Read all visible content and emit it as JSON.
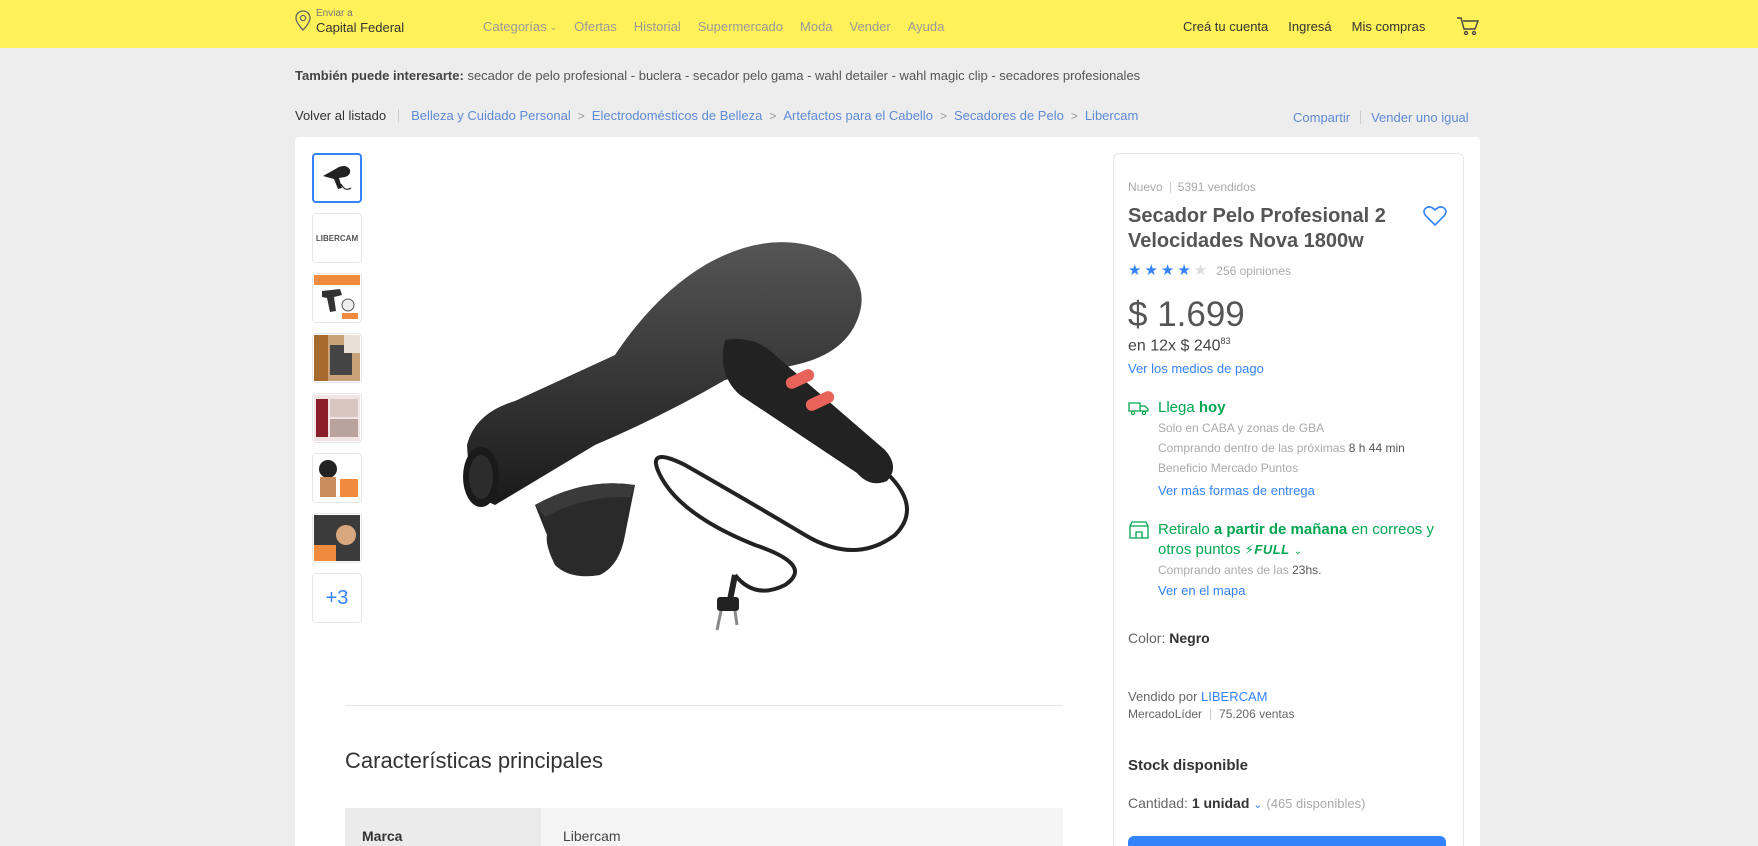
{
  "header": {
    "location": {
      "label": "Enviar a",
      "value": "Capital Federal"
    },
    "categories": [
      {
        "label": "Categorías",
        "has_chevron": true
      },
      {
        "label": "Ofertas"
      },
      {
        "label": "Historial"
      },
      {
        "label": "Supermercado"
      },
      {
        "label": "Moda"
      },
      {
        "label": "Vender"
      },
      {
        "label": "Ayuda"
      }
    ],
    "account": [
      "Creá tu cuenta",
      "Ingresá",
      "Mis compras"
    ],
    "cart_icon": "cart-icon",
    "bg_color": "#fff159"
  },
  "also_interest": {
    "label": "También puede interesarte:",
    "text": "secador de pelo profesional - buclera - secador pelo gama - wahl detailer - wahl magic clip - secadores profesionales"
  },
  "breadcrumb": {
    "back": "Volver al listado",
    "items": [
      "Belleza y Cuidado Personal",
      "Electrodomésticos de Belleza",
      "Artefactos para el Cabello",
      "Secadores de Pelo",
      "Libercam"
    ],
    "share": "Compartir",
    "sell_same": "Vender uno igual"
  },
  "gallery": {
    "thumbnails": [
      "hair-dryer",
      "libercam-logo",
      "product-promo",
      "product-lifestyle",
      "product-collage",
      "model-promo",
      "model-with-dryer"
    ],
    "more": "+3",
    "thumb_logo_text": "LIBERCAM"
  },
  "features": {
    "title": "Características principales",
    "rows": [
      {
        "key": "Marca",
        "value": "Libercam"
      }
    ]
  },
  "product": {
    "condition": "Nuevo",
    "sold": "5391 vendidos",
    "title": "Secador Pelo Profesional 2 Velocidades Nova 1800w",
    "rating": 4,
    "reviews": "256 opiniones",
    "price": "$ 1.699",
    "installments_prefix": "en 12x $ 240",
    "installments_cents": "83",
    "payment_link": "Ver los medios de pago",
    "arrival": {
      "prefix": "Llega",
      "bold": "hoy"
    },
    "arrival_note1": "Solo en CABA y zonas de GBA",
    "arrival_note2_prefix": "Comprando dentro de las próximas",
    "arrival_note2_time": "8 h 44 min",
    "arrival_note3": "Beneficio Mercado Puntos",
    "more_delivery": "Ver más formas de entrega",
    "pickup": {
      "prefix": "Retiralo",
      "bold": "a partir de mañana",
      "suffix": "en correos y otros puntos"
    },
    "full_badge": "FULL",
    "pickup_note_prefix": "Comprando antes de las",
    "pickup_note_time": "23hs.",
    "map_link": "Ver en el mapa",
    "color_label": "Color:",
    "color_value": "Negro",
    "seller_prefix": "Vendido por",
    "seller_name": "LIBERCAM",
    "seller_level": "MercadoLíder",
    "seller_sales": "75.206 ventas",
    "stock": "Stock disponible",
    "qty_label": "Cantidad:",
    "qty_value": "1 unidad",
    "qty_available": "(465 disponibles)"
  },
  "colors": {
    "accent": "#3483fa",
    "green": "#00a650",
    "yellow": "#fff159"
  }
}
